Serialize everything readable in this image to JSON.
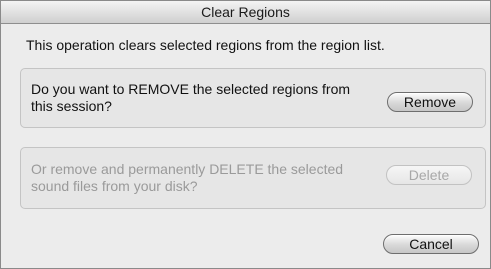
{
  "window": {
    "title": "Clear Regions"
  },
  "intro_text": "This operation clears selected regions from the region list.",
  "remove_section": {
    "question": "Do you want to REMOVE the selected regions from this session?",
    "button_label": "Remove"
  },
  "delete_section": {
    "question": "Or remove and permanently DELETE the selected sound files from your disk?",
    "button_label": "Delete",
    "enabled": false
  },
  "cancel_button_label": "Cancel",
  "colors": {
    "window_bg": "#ececec",
    "disabled_text": "#9a9a9a"
  }
}
